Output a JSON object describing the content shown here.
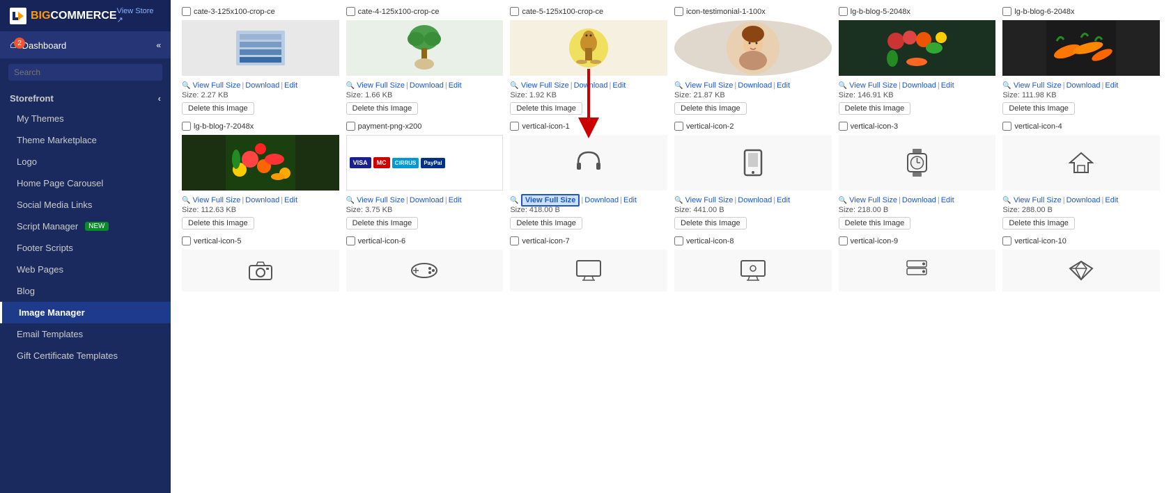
{
  "app": {
    "title": "BigCommerce",
    "view_store": "View Store ↗"
  },
  "sidebar": {
    "dashboard": "Dashboard",
    "dashboard_badge": "2",
    "search_placeholder": "Search",
    "storefront_label": "Storefront",
    "nav_items": [
      {
        "id": "my-themes",
        "label": "My Themes"
      },
      {
        "id": "theme-marketplace",
        "label": "Theme Marketplace"
      },
      {
        "id": "logo",
        "label": "Logo"
      },
      {
        "id": "home-page-carousel",
        "label": "Home Page Carousel"
      },
      {
        "id": "social-media-links",
        "label": "Social Media Links"
      },
      {
        "id": "script-manager",
        "label": "Script Manager",
        "badge": "NEW"
      },
      {
        "id": "footer-scripts",
        "label": "Footer Scripts"
      },
      {
        "id": "web-pages",
        "label": "Web Pages"
      },
      {
        "id": "blog",
        "label": "Blog"
      },
      {
        "id": "image-manager",
        "label": "Image Manager",
        "active": true
      },
      {
        "id": "email-templates",
        "label": "Email Templates"
      },
      {
        "id": "gift-certificate-templates",
        "label": "Gift Certificate Templates"
      }
    ]
  },
  "main": {
    "rows": [
      {
        "cells": [
          {
            "name": "cate-3-125x100-crop-ce",
            "size": "2.27 KB",
            "type": "image",
            "img": "towels"
          },
          {
            "name": "cate-4-125x100-crop-ce",
            "size": "1.66 KB",
            "type": "image",
            "img": "plant"
          },
          {
            "name": "cate-5-125x100-crop-ce",
            "size": "1.92 KB",
            "type": "image",
            "img": "horse"
          },
          {
            "name": "icon-testimonial-1-100x",
            "size": "21.87 KB",
            "type": "image",
            "img": "woman"
          },
          {
            "name": "lg-b-blog-5-2048x",
            "size": "146.91 KB",
            "type": "image",
            "img": "vegetables"
          },
          {
            "name": "lg-b-blog-6-2048x",
            "size": "111.98 KB",
            "type": "image",
            "img": "carrots"
          }
        ]
      },
      {
        "cells": [
          {
            "name": "lg-b-blog-7-2048x",
            "size": "112.63 KB",
            "type": "image",
            "img": "fruits"
          },
          {
            "name": "payment-png-x200",
            "size": "3.75 KB",
            "type": "payment"
          },
          {
            "name": "vertical-icon-1",
            "size": "418.00 B",
            "type": "icon",
            "icon": "🎧",
            "highlighted": true
          },
          {
            "name": "vertical-icon-2",
            "size": "441.00 B",
            "type": "icon",
            "icon": "📱"
          },
          {
            "name": "vertical-icon-3",
            "size": "218.00 B",
            "type": "icon",
            "icon": "⌚"
          },
          {
            "name": "vertical-icon-4",
            "size": "288.00 B",
            "type": "icon",
            "icon": "🏠"
          }
        ]
      },
      {
        "cells": [
          {
            "name": "vertical-icon-5",
            "size": "",
            "type": "icon",
            "icon": "📷"
          },
          {
            "name": "vertical-icon-6",
            "size": "",
            "type": "icon",
            "icon": "🎮"
          },
          {
            "name": "vertical-icon-7",
            "size": "",
            "type": "icon",
            "icon": "🖥"
          },
          {
            "name": "vertical-icon-8",
            "size": "",
            "type": "icon",
            "icon": "🖥"
          },
          {
            "name": "vertical-icon-9",
            "size": "",
            "type": "icon",
            "icon": "🗄"
          },
          {
            "name": "vertical-icon-10",
            "size": "",
            "type": "icon",
            "icon": "💎"
          }
        ]
      }
    ],
    "actions": {
      "view_full_size": "View Full Size",
      "download": "Download",
      "edit": "Edit",
      "delete": "Delete this Image",
      "size_label": "Size:"
    }
  }
}
